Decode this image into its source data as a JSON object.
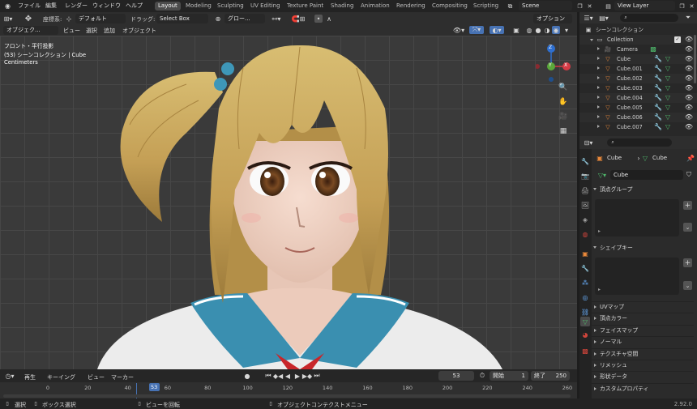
{
  "topbar": {
    "menus": [
      "ファイル",
      "編集",
      "レンダー",
      "ウィンドウ",
      "ヘルプ"
    ],
    "workspaces": [
      "Layout",
      "Modeling",
      "Sculpting",
      "UV Editing",
      "Texture Paint",
      "Shading",
      "Animation",
      "Rendering",
      "Compositing",
      "Scripting"
    ],
    "scene": "Scene",
    "view_layer": "View Layer"
  },
  "viewport_header": {
    "coord_label": "座標系:",
    "coord_value": "デフォルト",
    "drag_label": "ドラッグ:",
    "drag_value": "Select Box",
    "orient_value": "グロー...",
    "options": "オプション"
  },
  "viewport_header2": {
    "mode": "オブジェク...",
    "view": "ビュー",
    "select": "選択",
    "add": "追加",
    "object": "オブジェクト"
  },
  "viewport": {
    "view_name": "フロント・平行投影",
    "collection_info": "(53) シーンコレクション | Cube",
    "units": "Centimeters",
    "axis_x": "X",
    "axis_y": "Y",
    "axis_z": "Z"
  },
  "timeline": {
    "playback": "再生",
    "keying": "キーイング",
    "view": "ビュー",
    "marker": "マーカー",
    "current_frame": "53",
    "start_label": "開始",
    "start": "1",
    "end_label": "終了",
    "end": "250",
    "ticks": [
      "0",
      "20",
      "40",
      "53",
      "60",
      "80",
      "100",
      "120",
      "140",
      "160",
      "180",
      "200",
      "220",
      "240",
      "260"
    ]
  },
  "status": {
    "select": "選択",
    "box_select": "ボックス選択",
    "rotate_view": "ビューを回転",
    "context_menu": "オブジェクトコンテクストメニュー",
    "version": "2.92.0"
  },
  "outliner": {
    "root": "シーンコレクション",
    "collection": "Collection",
    "items": [
      "Camera",
      "Cube",
      "Cube.001",
      "Cube.002",
      "Cube.003",
      "Cube.004",
      "Cube.005",
      "Cube.006",
      "Cube.007"
    ]
  },
  "properties": {
    "object_name": "Cube",
    "data_name": "Cube",
    "mesh_name": "Cube",
    "sections_open": [
      "頂点グループ",
      "シェイプキー"
    ],
    "sections_closed": [
      "UVマップ",
      "頂点カラー",
      "フェイスマップ",
      "ノーマル",
      "テクスチャ空間",
      "リメッシュ",
      "形状データ",
      "カスタムプロパティ"
    ]
  },
  "colors": {
    "accent": "#4772b3",
    "workspace_active": "#4b4b4b",
    "object_orange": "#e8883a",
    "mesh_green": "#4fb86b"
  }
}
